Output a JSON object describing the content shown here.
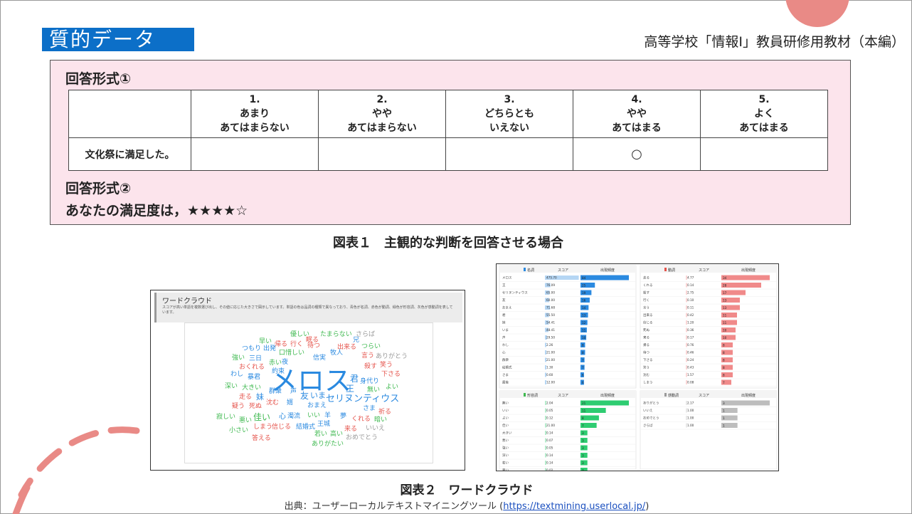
{
  "slide": {
    "title": "質的データ",
    "header": "高等学校「情報Ⅰ」教員研修用教材（本編）",
    "accent_color": "#0C6FC8",
    "deco_color": "#E98A86",
    "panel_bg": "#FCE4EC"
  },
  "form1": {
    "label": "回答形式①",
    "options": [
      {
        "num": "1.",
        "line1": "あまり",
        "line2": "あてはまらない"
      },
      {
        "num": "2.",
        "line1": "やや",
        "line2": "あてはまらない"
      },
      {
        "num": "3.",
        "line1": "どちらとも",
        "line2": "いえない"
      },
      {
        "num": "4.",
        "line1": "やや",
        "line2": "あてはまる"
      },
      {
        "num": "5.",
        "line1": "よく",
        "line2": "あてはまる"
      }
    ],
    "question": "文化祭に満足した。",
    "selected_mark": "○"
  },
  "form2": {
    "label": "回答形式②",
    "text": "あなたの満足度は，★★★★☆"
  },
  "caption1": "図表１　主観的な判断を回答させる場合",
  "wordcloud": {
    "title": "ワードクラウド",
    "description": "スコアが高い単語を複数選び出し、その値に応じた大きさで図示しています。単語の色は品詞の種類で異なっており、青色が名詞、赤色が動詞、緑色が形容詞、灰色が感動詞を表しています。",
    "words": [
      {
        "text": "メロス",
        "color": "#2b8ae0"
      },
      {
        "text": "セリヌンティウス",
        "color": "#2b8ae0"
      },
      {
        "text": "王",
        "color": "#2b8ae0"
      },
      {
        "text": "君",
        "color": "#2b8ae0"
      },
      {
        "text": "友",
        "color": "#2b8ae0"
      },
      {
        "text": "いま",
        "color": "#2b8ae0"
      },
      {
        "text": "おまえ",
        "color": "#2b8ae0"
      },
      {
        "text": "身代り",
        "color": "#2b8ae0"
      },
      {
        "text": "信実",
        "color": "#2b8ae0"
      },
      {
        "text": "牧人",
        "color": "#2b8ae0"
      },
      {
        "text": "兄",
        "color": "#2b8ae0"
      },
      {
        "text": "群衆",
        "color": "#2b8ae0"
      },
      {
        "text": "声",
        "color": "#2b8ae0"
      },
      {
        "text": "夜",
        "color": "#2b8ae0"
      },
      {
        "text": "三日",
        "color": "#2b8ae0"
      },
      {
        "text": "暴君",
        "color": "#2b8ae0"
      },
      {
        "text": "わし",
        "color": "#2b8ae0"
      },
      {
        "text": "さま",
        "color": "#2b8ae0"
      },
      {
        "text": "妹",
        "color": "#2b8ae0"
      },
      {
        "text": "心",
        "color": "#2b8ae0"
      },
      {
        "text": "濁流",
        "color": "#2b8ae0"
      },
      {
        "text": "羊",
        "color": "#2b8ae0"
      },
      {
        "text": "婿",
        "color": "#2b8ae0"
      },
      {
        "text": "王城",
        "color": "#2b8ae0"
      },
      {
        "text": "結婚式",
        "color": "#2b8ae0"
      },
      {
        "text": "出発",
        "color": "#2b8ae0"
      },
      {
        "text": "約束",
        "color": "#2b8ae0"
      },
      {
        "text": "夢",
        "color": "#2b8ae0"
      },
      {
        "text": "つもり",
        "color": "#2b8ae0"
      },
      {
        "text": "走る",
        "color": "#e5534b"
      },
      {
        "text": "死ぬ",
        "color": "#e5534b"
      },
      {
        "text": "殺す",
        "color": "#e5534b"
      },
      {
        "text": "言う",
        "color": "#e5534b"
      },
      {
        "text": "笑う",
        "color": "#e5534b"
      },
      {
        "text": "来る",
        "color": "#e5534b"
      },
      {
        "text": "出来る",
        "color": "#e5534b"
      },
      {
        "text": "くれる",
        "color": "#e5534b"
      },
      {
        "text": "おくれる",
        "color": "#e5534b"
      },
      {
        "text": "待つ",
        "color": "#e5534b"
      },
      {
        "text": "行く",
        "color": "#e5534b"
      },
      {
        "text": "眠る",
        "color": "#e5534b"
      },
      {
        "text": "疑う",
        "color": "#e5534b"
      },
      {
        "text": "沈む",
        "color": "#e5534b"
      },
      {
        "text": "しまう",
        "color": "#e5534b"
      },
      {
        "text": "信じる",
        "color": "#e5534b"
      },
      {
        "text": "答える",
        "color": "#e5534b"
      },
      {
        "text": "下さる",
        "color": "#e5534b"
      },
      {
        "text": "祈る",
        "color": "#e5534b"
      },
      {
        "text": "帰る",
        "color": "#e5534b"
      },
      {
        "text": "優しい",
        "color": "#3fb950"
      },
      {
        "text": "早い",
        "color": "#3fb950"
      },
      {
        "text": "口惜しい",
        "color": "#3fb950"
      },
      {
        "text": "つらい",
        "color": "#3fb950"
      },
      {
        "text": "強い",
        "color": "#3fb950"
      },
      {
        "text": "赤い",
        "color": "#3fb950"
      },
      {
        "text": "深い",
        "color": "#3fb950"
      },
      {
        "text": "大きい",
        "color": "#3fb950"
      },
      {
        "text": "佳い",
        "color": "#3fb950"
      },
      {
        "text": "悪い",
        "color": "#3fb950"
      },
      {
        "text": "寂しい",
        "color": "#3fb950"
      },
      {
        "text": "小さい",
        "color": "#3fb950"
      },
      {
        "text": "いい",
        "color": "#3fb950"
      },
      {
        "text": "若い",
        "color": "#3fb950"
      },
      {
        "text": "高い",
        "color": "#3fb950"
      },
      {
        "text": "無い",
        "color": "#3fb950"
      },
      {
        "text": "よい",
        "color": "#3fb950"
      },
      {
        "text": "暗い",
        "color": "#3fb950"
      },
      {
        "text": "ありがたい",
        "color": "#3fb950"
      },
      {
        "text": "たまらない",
        "color": "#3fb950"
      },
      {
        "text": "さらば",
        "color": "#9a9a9a"
      },
      {
        "text": "ありがとう",
        "color": "#9a9a9a"
      },
      {
        "text": "いいえ",
        "color": "#9a9a9a"
      },
      {
        "text": "おめでとう",
        "color": "#9a9a9a"
      }
    ]
  },
  "score_tables": [
    {
      "title": "名詞",
      "header_color": "#2b8ae0",
      "bar_color": "#2b8ae0",
      "columns": [
        "スコア",
        "出現頻度"
      ],
      "rows": [
        {
          "word": "メロス",
          "score": "475.70",
          "freq": 84
        },
        {
          "word": "王",
          "score": "76.09",
          "freq": 25
        },
        {
          "word": "セリヌンティウス",
          "score": "65.00",
          "freq": 19
        },
        {
          "word": "友",
          "score": "60.00",
          "freq": 16
        },
        {
          "word": "おまえ",
          "score": "71.68",
          "freq": 14
        },
        {
          "word": "君",
          "score": "55.50",
          "freq": 13
        },
        {
          "word": "妹",
          "score": "54.41",
          "freq": 12
        },
        {
          "word": "いま",
          "score": "48.41",
          "freq": 11
        },
        {
          "word": "声",
          "score": "29.50",
          "freq": 10
        },
        {
          "word": "わし",
          "score": "2.26",
          "freq": 8
        },
        {
          "word": "心",
          "score": "21.00",
          "freq": 8
        },
        {
          "word": "群衆",
          "score": "21.00",
          "freq": 7
        },
        {
          "word": "結婚式",
          "score": "1.30",
          "freq": 7
        },
        {
          "word": "さま",
          "score": "0.60",
          "freq": 6
        },
        {
          "word": "最後",
          "score": "12.00",
          "freq": 6
        }
      ]
    },
    {
      "title": "動詞",
      "header_color": "#e5534b",
      "bar_color": "#f08a8a",
      "columns": [
        "スコア",
        "出現頻度"
      ],
      "rows": [
        {
          "word": "走る",
          "score": "4.77",
          "freq": 34
        },
        {
          "word": "くれる",
          "score": "0.14",
          "freq": 28
        },
        {
          "word": "殺す",
          "score": "2.75",
          "freq": 17
        },
        {
          "word": "行く",
          "score": "0.10",
          "freq": 13
        },
        {
          "word": "言う",
          "score": "0.11",
          "freq": 13
        },
        {
          "word": "出来る",
          "score": "0.42",
          "freq": 11
        },
        {
          "word": "信じる",
          "score": "1.20",
          "freq": 11
        },
        {
          "word": "死ぬ",
          "score": "0.36",
          "freq": 10
        },
        {
          "word": "来る",
          "score": "0.17",
          "freq": 10
        },
        {
          "word": "帰る",
          "score": "0.76",
          "freq": 8
        },
        {
          "word": "待つ",
          "score": "0.46",
          "freq": 8
        },
        {
          "word": "下さる",
          "score": "0.24",
          "freq": 8
        },
        {
          "word": "笑う",
          "score": "0.43",
          "freq": 8
        },
        {
          "word": "沈む",
          "score": "1.57",
          "freq": 8
        },
        {
          "word": "しまう",
          "score": "0.08",
          "freq": 7
        }
      ]
    },
    {
      "title": "形容詞",
      "header_color": "#3fb950",
      "bar_color": "#2ecc71",
      "columns": [
        "スコア",
        "出現頻度"
      ],
      "rows": [
        {
          "word": "無い",
          "score": "2.04",
          "freq": 21
        },
        {
          "word": "いい",
          "score": "0.05",
          "freq": 11
        },
        {
          "word": "よい",
          "score": "0.12",
          "freq": 8
        },
        {
          "word": "佳い",
          "score": "21.00",
          "freq": 7
        },
        {
          "word": "大きい",
          "score": "0.14",
          "freq": 3
        },
        {
          "word": "悪い",
          "score": "0.07",
          "freq": 3
        },
        {
          "word": "強い",
          "score": "0.05",
          "freq": 3
        },
        {
          "word": "深い",
          "score": "0.14",
          "freq": 3
        },
        {
          "word": "若い",
          "score": "0.14",
          "freq": 3
        },
        {
          "word": "暑い",
          "score": "0.02",
          "freq": 3
        }
      ]
    },
    {
      "title": "感動詞",
      "header_color": "#9a9a9a",
      "bar_color": "#bdbdbd",
      "columns": [
        "スコア",
        "出現頻度"
      ],
      "rows": [
        {
          "word": "ありがとう",
          "score": "2.17",
          "freq": 3
        },
        {
          "word": "いいえ",
          "score": "1.00",
          "freq": 1
        },
        {
          "word": "おめでとう",
          "score": "1.00",
          "freq": 1
        },
        {
          "word": "さらば",
          "score": "1.00",
          "freq": 1
        }
      ]
    }
  ],
  "caption2": "図表２　ワードクラウド",
  "source": {
    "prefix": "出典：ユーザーローカルテキストマイニングツール (",
    "url": "https://textmining.userlocal.jp/",
    "suffix": ")"
  }
}
